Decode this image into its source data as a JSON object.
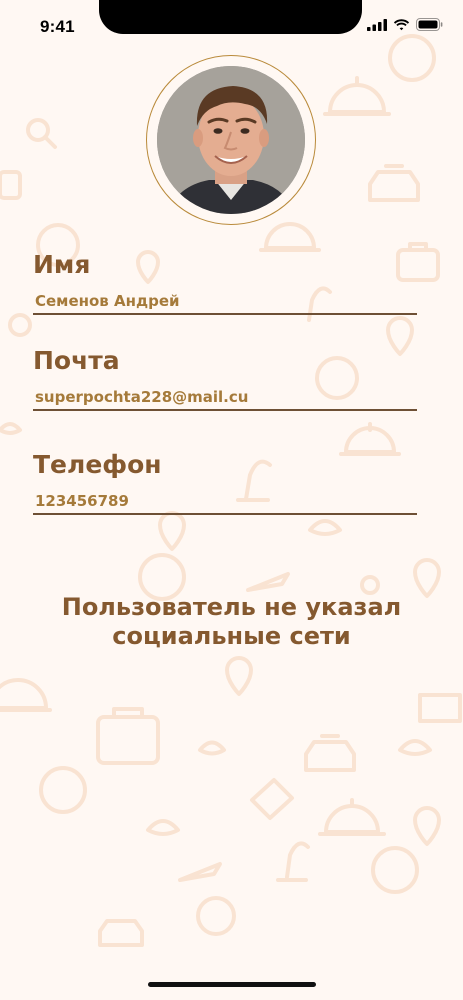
{
  "status_bar": {
    "time": "9:41"
  },
  "profile": {
    "avatar_alt": "profile-photo"
  },
  "fields": {
    "name": {
      "label": "Имя",
      "value": "Семенов Андрей"
    },
    "email": {
      "label": "Почта",
      "value": "superpochta228@mail.cu"
    },
    "phone": {
      "label": "Телефон",
      "value": "123456789"
    }
  },
  "social": {
    "empty_message_line1": "Пользователь не указал",
    "empty_message_line2": "социальные сети"
  },
  "colors": {
    "background": "#fff8f3",
    "label": "#85592f",
    "value": "#a57a3a",
    "underline": "#6e5035",
    "avatar_ring": "#b98a3a"
  }
}
